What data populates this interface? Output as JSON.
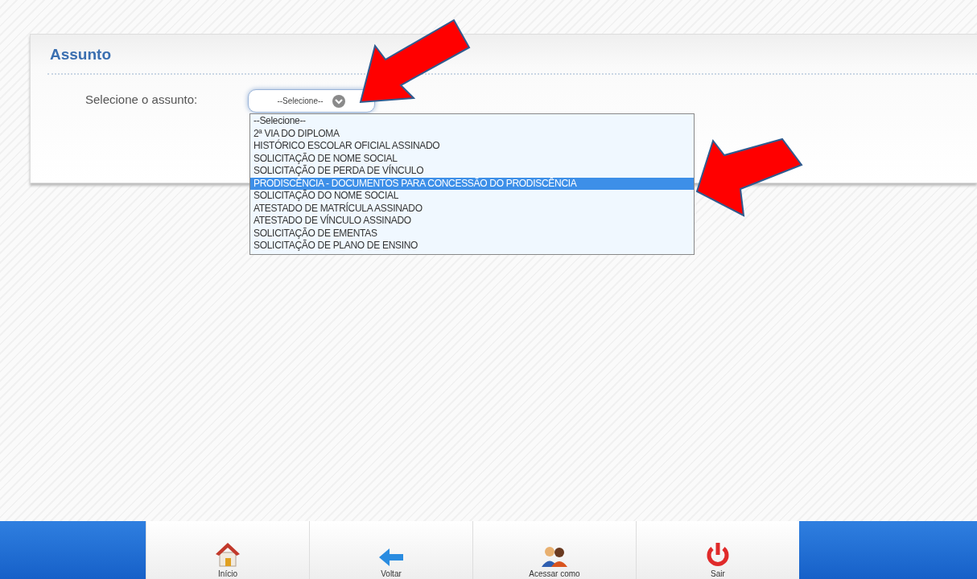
{
  "panel": {
    "title": "Assunto",
    "field_label": "Selecione o assunto:",
    "select": {
      "value": "--Selecione--",
      "expanded": true,
      "options": [
        {
          "label": "--Selecione--",
          "highlighted": false
        },
        {
          "label": "2ª VIA DO DIPLOMA",
          "highlighted": false
        },
        {
          "label": "HISTÓRICO ESCOLAR OFICIAL ASSINADO",
          "highlighted": false
        },
        {
          "label": "SOLICITAÇÃO DE NOME SOCIAL",
          "highlighted": false
        },
        {
          "label": "SOLICITAÇÃO DE PERDA DE VÍNCULO",
          "highlighted": false
        },
        {
          "label": "PRODISCÊNCIA - DOCUMENTOS PARA CONCESSÃO DO PRODISCÊNCIA",
          "highlighted": true
        },
        {
          "label": "SOLICITAÇÃO DO NOME SOCIAL",
          "highlighted": false
        },
        {
          "label": "ATESTADO DE MATRÍCULA ASSINADO",
          "highlighted": false
        },
        {
          "label": "ATESTADO DE VÍNCULO ASSINADO",
          "highlighted": false
        },
        {
          "label": "SOLICITAÇÃO DE EMENTAS",
          "highlighted": false
        },
        {
          "label": "SOLICITAÇÃO DE PLANO DE ENSINO",
          "highlighted": false
        }
      ]
    }
  },
  "footer": {
    "buttons": [
      {
        "kind": "home",
        "label": "Início"
      },
      {
        "kind": "back",
        "label": "Voltar"
      },
      {
        "kind": "users",
        "label": "Acessar como"
      },
      {
        "kind": "power",
        "label": "Sair"
      }
    ]
  }
}
